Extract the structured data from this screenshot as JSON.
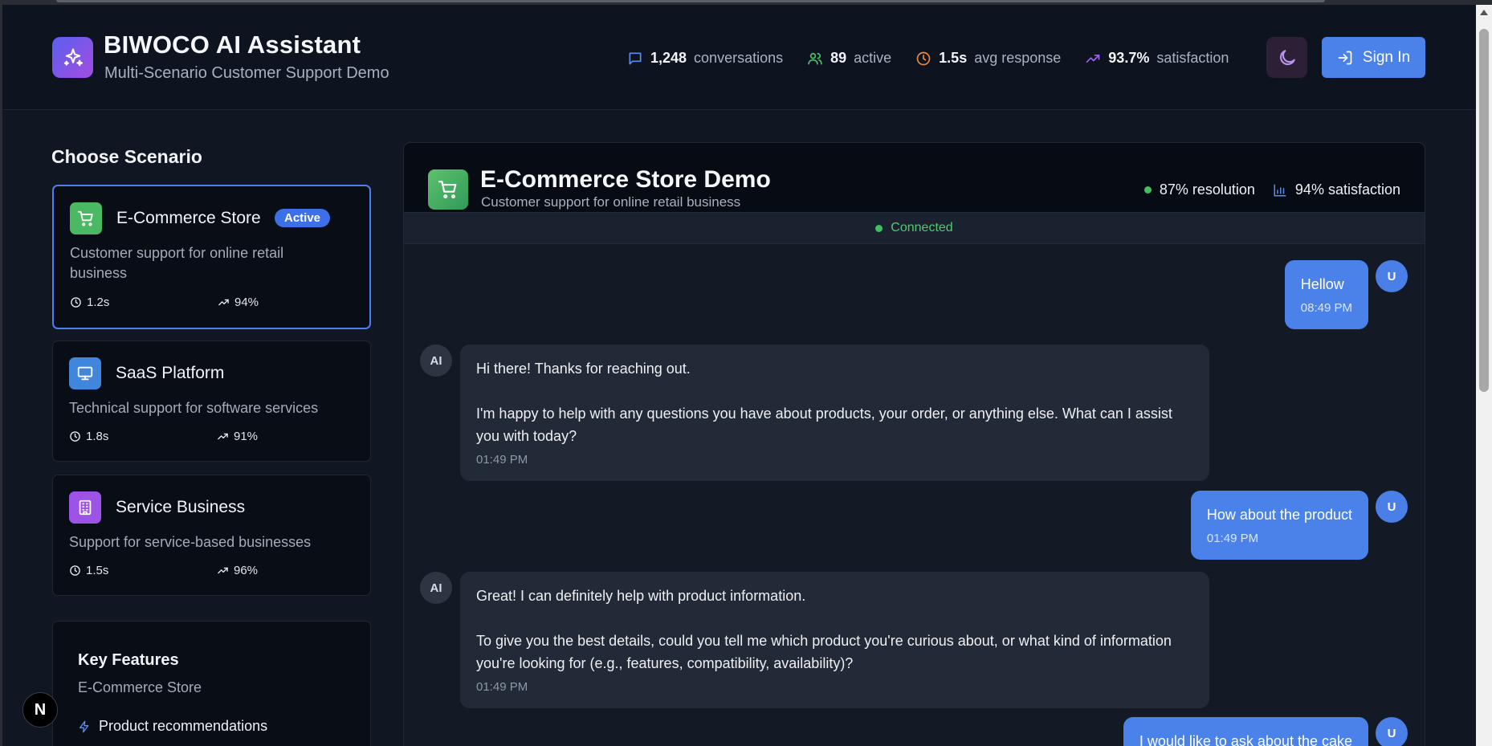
{
  "header": {
    "title": "BIWOCO AI Assistant",
    "subtitle": "Multi-Scenario Customer Support Demo",
    "stats": [
      {
        "value": "1,248",
        "label": "conversations",
        "icon": "message-square-icon",
        "color": "#5b8def"
      },
      {
        "value": "89",
        "label": "active",
        "icon": "users-icon",
        "color": "#4fbf6a"
      },
      {
        "value": "1.5s",
        "label": "avg response",
        "icon": "clock-icon",
        "color": "#f08a3a"
      },
      {
        "value": "93.7%",
        "label": "satisfaction",
        "icon": "trending-up-icon",
        "color": "#a162f0"
      }
    ],
    "theme_toggle_icon": "moon-icon",
    "signin_label": "Sign In"
  },
  "sidebar": {
    "title": "Choose Scenario",
    "scenarios": [
      {
        "name": "E-Commerce Store",
        "badge": "Active",
        "description": "Customer support for online retail business",
        "response_time": "1.2s",
        "satisfaction": "94%",
        "icon": "shopping-cart-icon",
        "color": "#4bb864",
        "active": true
      },
      {
        "name": "SaaS Platform",
        "description": "Technical support for software services",
        "response_time": "1.8s",
        "satisfaction": "91%",
        "icon": "monitor-icon",
        "color": "#3f86dc",
        "active": false
      },
      {
        "name": "Service Business",
        "description": "Support for service-based businesses",
        "response_time": "1.5s",
        "satisfaction": "96%",
        "icon": "building-icon",
        "color": "#9d54e6",
        "active": false
      }
    ],
    "features": {
      "title": "Key Features",
      "subtitle": "E-Commerce Store",
      "items": [
        "Product recommendations"
      ]
    }
  },
  "chat": {
    "title": "E-Commerce Store Demo",
    "subtitle": "Customer support for online retail business",
    "resolution": "87% resolution",
    "satisfaction": "94% satisfaction",
    "status": "Connected",
    "messages": [
      {
        "role": "user",
        "avatar": "U",
        "text": "Hellow",
        "time": "08:49 PM"
      },
      {
        "role": "ai",
        "avatar": "AI",
        "text": "Hi there! Thanks for reaching out.\n\nI'm happy to help with any questions you have about products, your order, or anything else. What can I assist you with today?",
        "time": "01:49 PM"
      },
      {
        "role": "user",
        "avatar": "U",
        "text": "How about the product",
        "time": "01:49 PM"
      },
      {
        "role": "ai",
        "avatar": "AI",
        "text": "Great! I can definitely help with product information.\n\nTo give you the best details, could you tell me which product you're curious about, or what kind of information you're looking for (e.g., features, compatibility, availability)?",
        "time": "01:49 PM"
      },
      {
        "role": "user",
        "avatar": "U",
        "text": "I would like to ask about the cake",
        "time": ""
      }
    ]
  },
  "floating": {
    "next_badge": "N"
  }
}
